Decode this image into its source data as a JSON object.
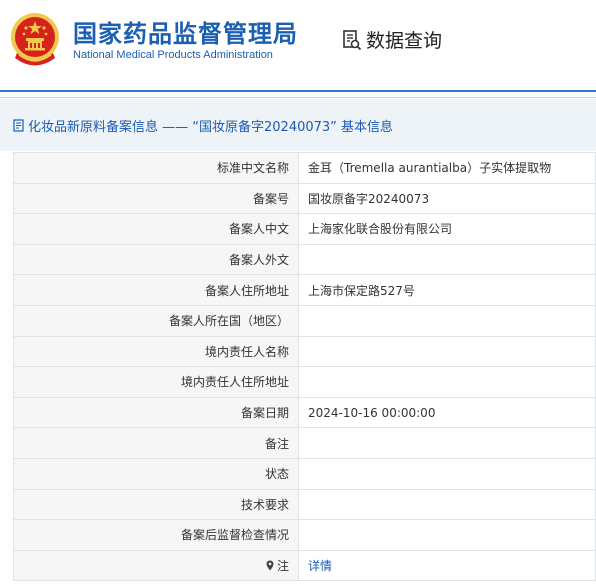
{
  "header": {
    "org_name_cn": "国家药品监督管理局",
    "org_name_en": "National Medical Products Administration",
    "query_label": "数据查询",
    "emblem_icon": "national-emblem-icon",
    "query_icon": "document-search-icon"
  },
  "panel": {
    "title": "化妆品新原料备案信息 —— “国妆原备字20240073” 基本信息",
    "title_icon": "document-icon"
  },
  "rows": [
    {
      "label": "标准中文名称",
      "value": "金耳（Tremella aurantialba）子实体提取物"
    },
    {
      "label": "备案号",
      "value": "国妆原备字20240073"
    },
    {
      "label": "备案人中文",
      "value": "上海家化联合股份有限公司"
    },
    {
      "label": "备案人外文",
      "value": ""
    },
    {
      "label": "备案人住所地址",
      "value": "上海市保定路527号"
    },
    {
      "label": "备案人所在国（地区）",
      "value": ""
    },
    {
      "label": "境内责任人名称",
      "value": ""
    },
    {
      "label": "境内责任人住所地址",
      "value": ""
    },
    {
      "label": "备案日期",
      "value": "2024-10-16 00:00:00"
    },
    {
      "label": "备注",
      "value": ""
    },
    {
      "label": "状态",
      "value": ""
    },
    {
      "label": "技术要求",
      "value": ""
    },
    {
      "label": "备案后监督检查情况",
      "value": ""
    }
  ],
  "note_row": {
    "label": "注",
    "link_text": "详情",
    "icon": "pin-icon"
  },
  "colors": {
    "brand_blue": "#1c5fb0",
    "link_blue": "#1a5bb5",
    "emblem_red": "#d7211c",
    "emblem_gold": "#f2c94c"
  }
}
